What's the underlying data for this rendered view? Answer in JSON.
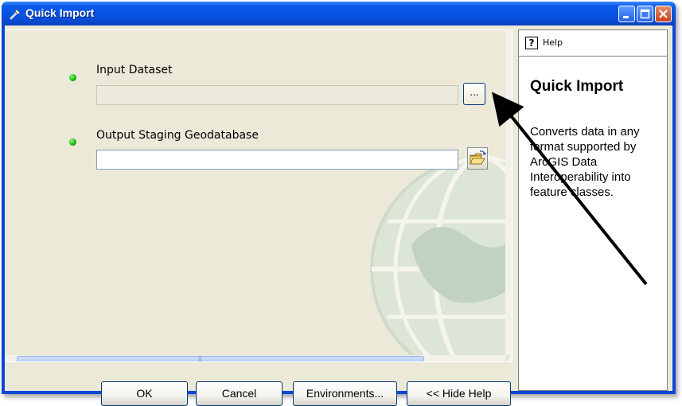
{
  "window": {
    "title": "Quick Import"
  },
  "form": {
    "input_dataset": {
      "label": "Input Dataset",
      "value": "",
      "browse_label": "..."
    },
    "output_geodatabase": {
      "label": "Output Staging Geodatabase",
      "value": ""
    }
  },
  "buttons": {
    "ok": "OK",
    "cancel": "Cancel",
    "environments": "Environments...",
    "hide_help": "<< Hide Help"
  },
  "help": {
    "tab_label": "Help",
    "title": "Quick Import",
    "description": "Converts data in any format supported by ArcGIS Data Interoperability into feature classes."
  },
  "colors": {
    "titlebar": "#0654e4",
    "required_dot": "#10b010",
    "dialog_bg": "#ece9d8"
  },
  "icons": [
    "tool-icon",
    "minimize-icon",
    "maximize-icon",
    "close-icon",
    "folder-open-icon",
    "help-icon",
    "globe-watermark"
  ]
}
